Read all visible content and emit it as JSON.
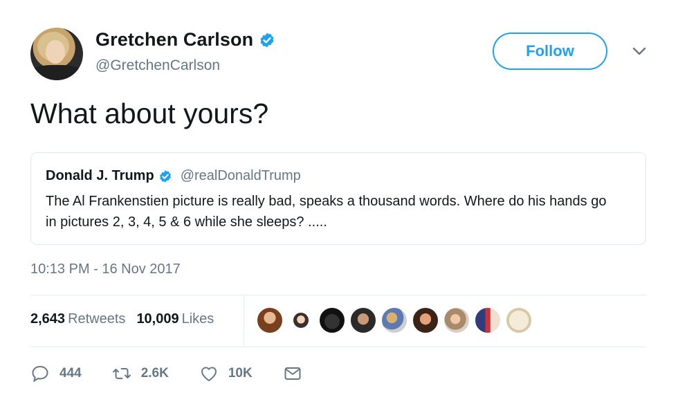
{
  "author": {
    "name": "Gretchen Carlson",
    "handle": "@GretchenCarlson",
    "verified": true
  },
  "follow_label": "Follow",
  "tweet_text": "What about yours?",
  "quoted": {
    "name": "Donald J. Trump",
    "handle": "@realDonaldTrump",
    "text": "The Al Frankenstien picture is really bad, speaks a thousand words. Where do his hands go in pictures 2, 3, 4, 5 & 6 while she sleeps? ....."
  },
  "timestamp": "10:13 PM - 16 Nov 2017",
  "stats": {
    "retweets_count": "2,643",
    "retweets_label": "Retweets",
    "likes_count": "10,009",
    "likes_label": "Likes"
  },
  "actions": {
    "replies": "444",
    "retweets": "2.6K",
    "likes": "10K"
  },
  "colors": {
    "accent": "#1da1f2",
    "secondary_text": "#657786",
    "divider": "#e6ecf0"
  },
  "icons": [
    "verified-badge-icon",
    "chevron-down-icon",
    "reply-icon",
    "retweet-icon",
    "like-icon",
    "message-icon"
  ]
}
